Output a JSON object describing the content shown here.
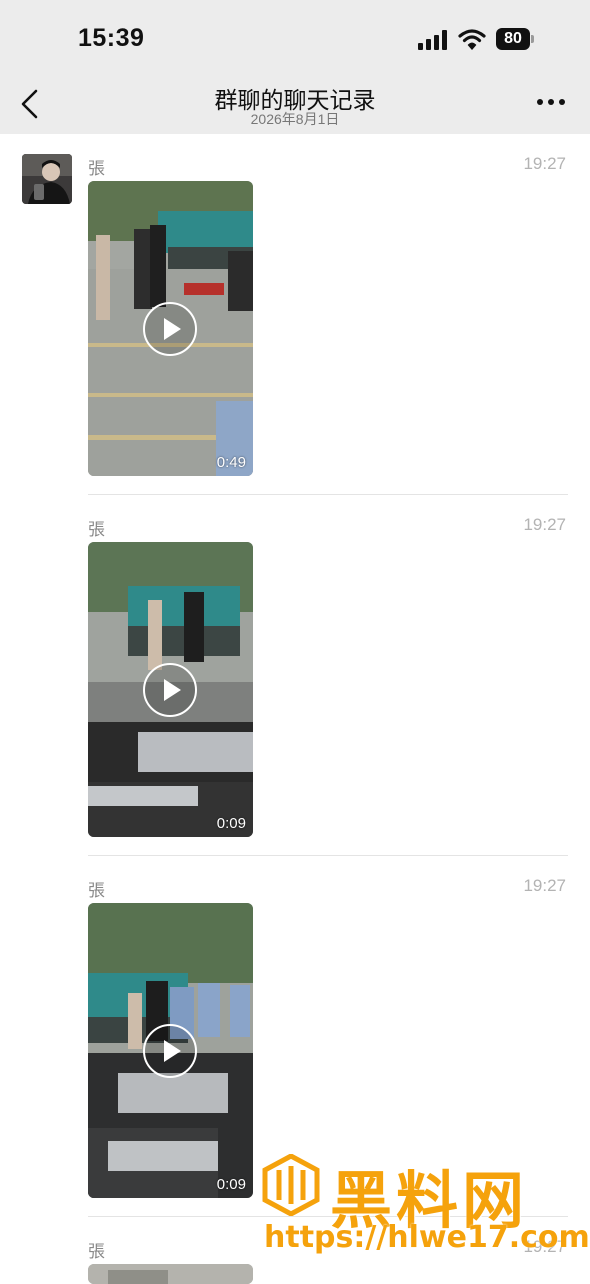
{
  "status_bar": {
    "time": "15:39",
    "battery": "80"
  },
  "nav": {
    "title": "群聊的聊天记录",
    "subtitle": "2026年8月1日"
  },
  "messages": [
    {
      "sender": "張",
      "time": "19:27",
      "duration": "0:49"
    },
    {
      "sender": "張",
      "time": "19:27",
      "duration": "0:09"
    },
    {
      "sender": "張",
      "time": "19:27",
      "duration": "0:09"
    },
    {
      "sender": "張",
      "time": "19:27"
    }
  ],
  "watermark": {
    "brand": "黑料网",
    "url": "https://hlwe17.com"
  },
  "colors": {
    "background": "#ececec",
    "watermark": "#f5a20c"
  },
  "icons": [
    "back-chevron-icon",
    "more-dots-icon",
    "play-icon",
    "signal-icon",
    "wifi-icon",
    "battery-icon"
  ]
}
